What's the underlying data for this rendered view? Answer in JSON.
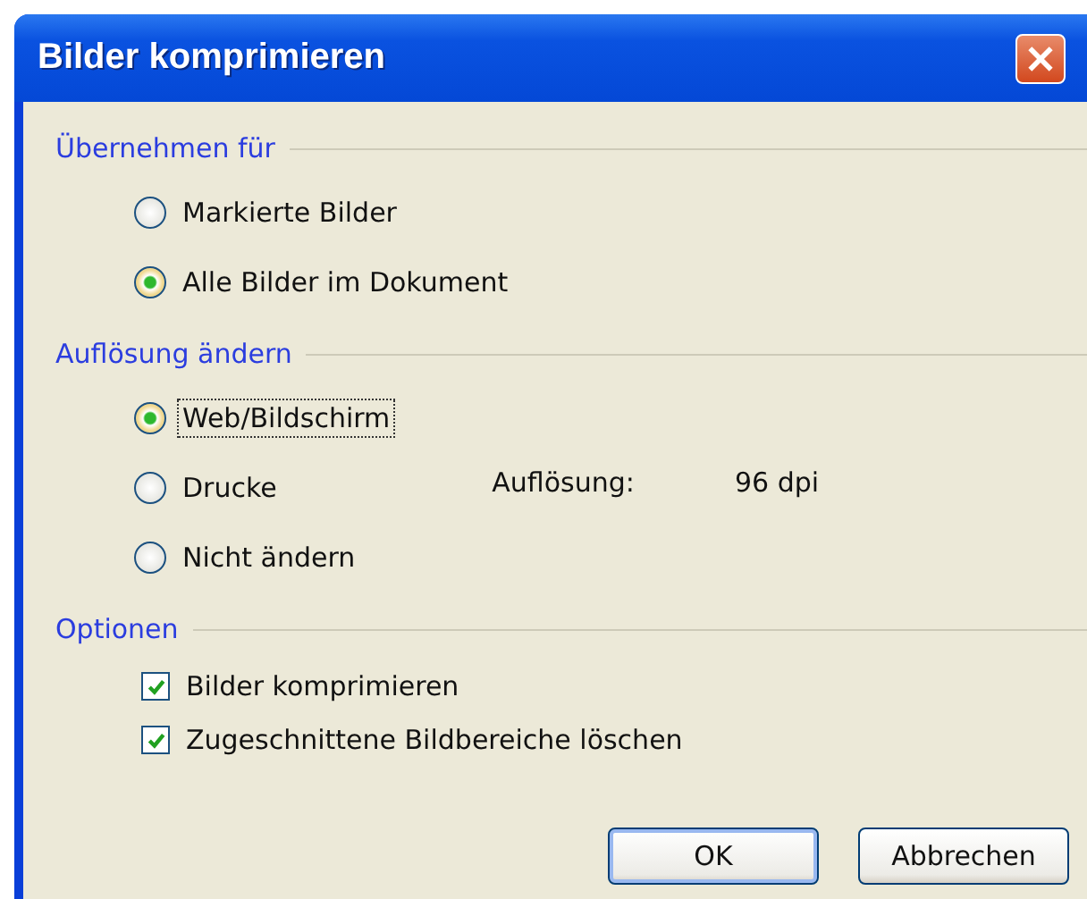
{
  "window": {
    "title": "Bilder komprimieren"
  },
  "sections": [
    {
      "title": "Übernehmen für",
      "kind": "radios",
      "items": [
        {
          "label": "Markierte Bilder",
          "selected": false,
          "focused": false
        },
        {
          "label": "Alle Bilder im Dokument",
          "selected": true,
          "focused": false
        }
      ]
    },
    {
      "title": "Auflösung ändern",
      "kind": "radios",
      "items": [
        {
          "label": "Web/Bildschirm",
          "selected": true,
          "focused": true
        },
        {
          "label": "Drucke",
          "selected": false,
          "focused": false
        },
        {
          "label": "Nicht ändern",
          "selected": false,
          "focused": false
        }
      ],
      "info": {
        "label": "Auflösung:",
        "value": "96 dpi"
      }
    },
    {
      "title": "Optionen",
      "kind": "checks",
      "items": [
        {
          "label": "Bilder komprimieren",
          "checked": true
        },
        {
          "label": "Zugeschnittene Bildbereiche löschen",
          "checked": true
        }
      ]
    }
  ],
  "buttons": [
    {
      "label": "OK",
      "default": true
    },
    {
      "label": "Abbrechen",
      "default": false
    }
  ]
}
